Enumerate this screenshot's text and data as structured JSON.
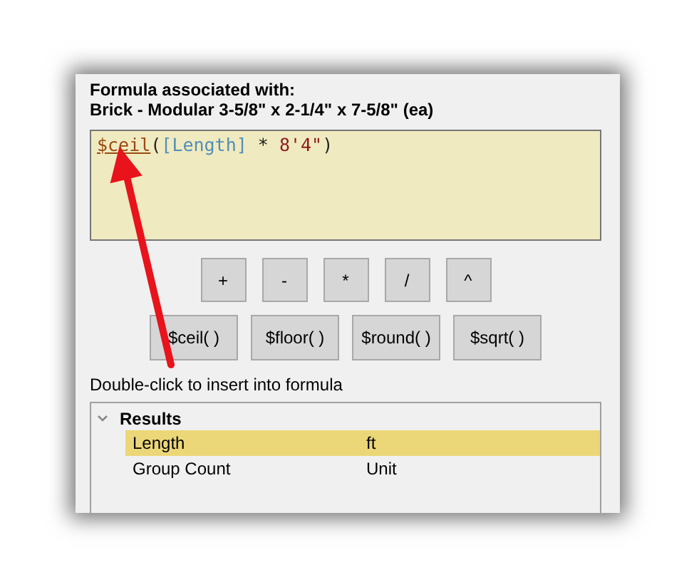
{
  "header": {
    "label": "Formula associated with:",
    "item": "Brick - Modular 3-5/8\" x 2-1/4\" x 7-5/8\" (ea)"
  },
  "formula": {
    "tokens": [
      {
        "text": "$ceil",
        "kind": "function"
      },
      {
        "text": "(",
        "kind": "punct"
      },
      {
        "text": "[Length]",
        "kind": "field"
      },
      {
        "text": " * ",
        "kind": "operator"
      },
      {
        "text": "8'4\"",
        "kind": "literal"
      },
      {
        "text": ")",
        "kind": "punct"
      }
    ]
  },
  "operator_buttons": [
    "+",
    "-",
    "*",
    "/",
    "^"
  ],
  "function_buttons": [
    "$ceil( )",
    "$floor( )",
    "$round( )",
    "$sqrt( )"
  ],
  "hint": "Double-click to insert into formula",
  "results": {
    "label": "Results",
    "expanded": true,
    "children": [
      {
        "name": "Length",
        "unit": "ft",
        "selected": true
      },
      {
        "name": "Group Count",
        "unit": "Unit",
        "selected": false
      }
    ]
  }
}
